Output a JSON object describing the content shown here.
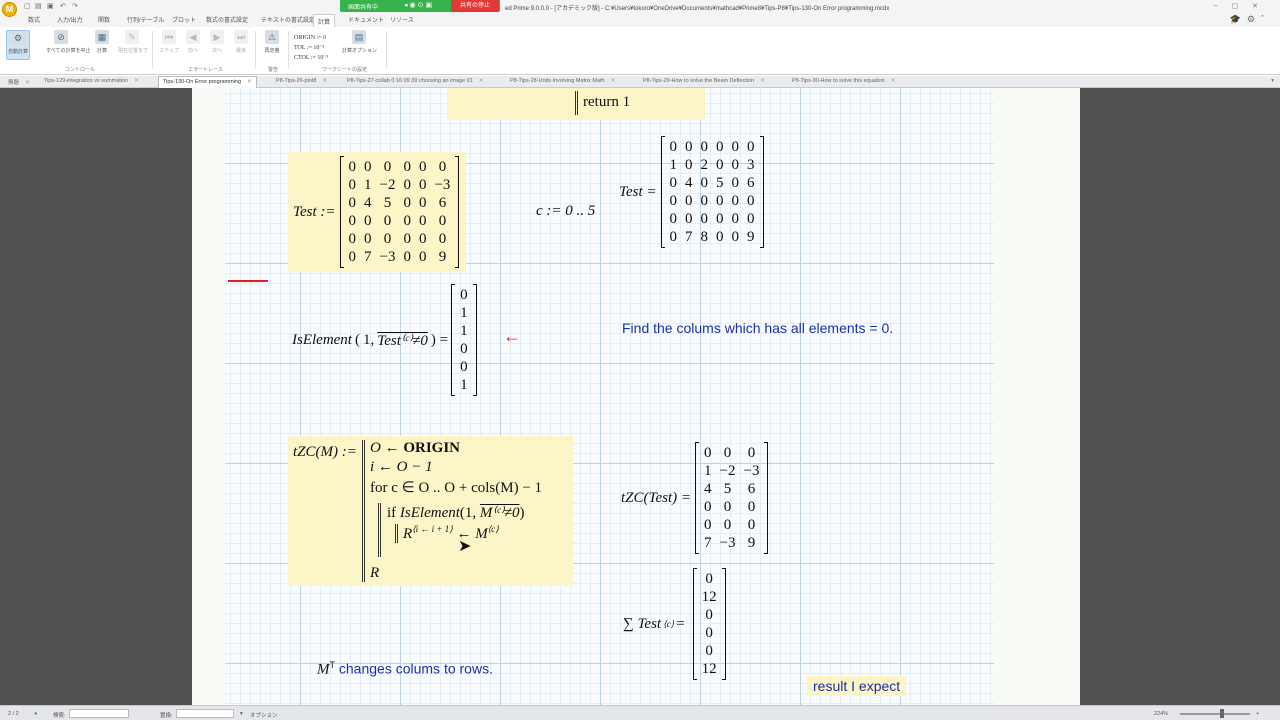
{
  "window": {
    "title": "ed Prime 9.0.0.0 - [アカデミック版] - C:¥Users¥tokoro¥OneDrive¥Documents¥mathcad¥Prime8¥Tips-P8¥Tips-130-On Error programming.mcdx",
    "share_status": "画面共有中",
    "stop_share": "共有の停止"
  },
  "ribbon_tabs": [
    "数式",
    "入力/出力",
    "関数",
    "行列/テーブル",
    "プロット",
    "数式の書式設定",
    "テキストの書式設定",
    "計算",
    "ドキュメント",
    "リソース"
  ],
  "ribbon_active_tab": "計算",
  "ribbon": {
    "buttons": [
      "自動計算",
      "すべての計算を中止",
      "計算",
      "現在位置まで",
      "ステップ",
      "前へ",
      "次へ",
      "最後",
      "再定義"
    ],
    "variables": {
      "origin": "ORIGIN := 0",
      "tol": "TOL := 10⁻³",
      "ctol": "CTOL := 10⁻³"
    },
    "calc_options": "計算オプション",
    "groups": [
      "コントロール",
      "エラートレース",
      "警告",
      "ワークシートの設定"
    ]
  },
  "doc_tabs": [
    "無題",
    "Tips-129-integration vs summation",
    "Tips-130-On Error programming",
    "P8-Tips-26-plot8",
    "P8-Tips-27-collab 0 16 09 39 choosing an image 01",
    "P8-Tips-28-Units Involving Matrix Math",
    "P8-Tips-29-How to solve the Beam Deflection",
    "P8-Tips-30-How to solve this equation"
  ],
  "doc_active_tab": "Tips-130-On Error programming",
  "worksheet": {
    "return_stmt": "return 1",
    "test_def_label": "Test :=",
    "test_matrix": [
      [
        0,
        0,
        0,
        0,
        0,
        0
      ],
      [
        0,
        1,
        -2,
        0,
        0,
        -3
      ],
      [
        0,
        4,
        5,
        0,
        0,
        6
      ],
      [
        0,
        0,
        0,
        0,
        0,
        0
      ],
      [
        0,
        0,
        0,
        0,
        0,
        0
      ],
      [
        0,
        7,
        -3,
        0,
        0,
        9
      ]
    ],
    "range_def": "c := 0 .. 5",
    "test_result_label": "Test =",
    "test_transposed": [
      [
        0,
        0,
        0,
        0,
        0,
        0
      ],
      [
        1,
        0,
        2,
        0,
        0,
        3
      ],
      [
        0,
        4,
        0,
        5,
        0,
        6
      ],
      [
        0,
        0,
        0,
        0,
        0,
        0
      ],
      [
        0,
        0,
        0,
        0,
        0,
        0
      ],
      [
        0,
        7,
        8,
        0,
        0,
        9
      ]
    ],
    "iselement_call": "IsElement",
    "iselement_args": "1, ",
    "iselement_vec_text": "Test⁽ᶜ⁾≠0",
    "iselement_result": [
      0,
      1,
      1,
      0,
      0,
      1
    ],
    "arrow_note": "←",
    "note_find": "Find the colums which has all elements = 0.",
    "fn_def": "tZC(M) :=",
    "prog_lines": {
      "l1": "O ← ",
      "l1b": "ORIGIN",
      "l2": "i ← O − 1",
      "l3": "for c ∈ O .. O + cols(M) − 1",
      "l4a": "if ",
      "l4b": "IsElement",
      "l4c": "(1, ",
      "l4d": "M⁽ᶜ⁾≠0",
      "l4e": ")",
      "l5": "R",
      "l5sup": "⟨i ← i + 1⟩",
      "l5b": " ← M",
      "l5csup": "⟨c⟩",
      "l6": "R"
    },
    "tzc_call": "tZC(Test) =",
    "tzc_result": [
      [
        0,
        0,
        0
      ],
      [
        1,
        -2,
        -3
      ],
      [
        4,
        5,
        6
      ],
      [
        0,
        0,
        0
      ],
      [
        0,
        0,
        0
      ],
      [
        7,
        -3,
        9
      ]
    ],
    "sum_label": "∑ Test",
    "sum_sup": "⟨c⟩",
    "sum_eq": " =",
    "sum_result": [
      0,
      12,
      0,
      0,
      0,
      12
    ],
    "note_transpose_var": "M",
    "note_transpose_sup": "T",
    "note_transpose": " changes colums to rows.",
    "note_expect": "result I expect"
  },
  "status": {
    "page": "2 / 2",
    "search_label": "検索:",
    "replace_label": "置換:",
    "options": "オプション",
    "zoom": "224%"
  }
}
